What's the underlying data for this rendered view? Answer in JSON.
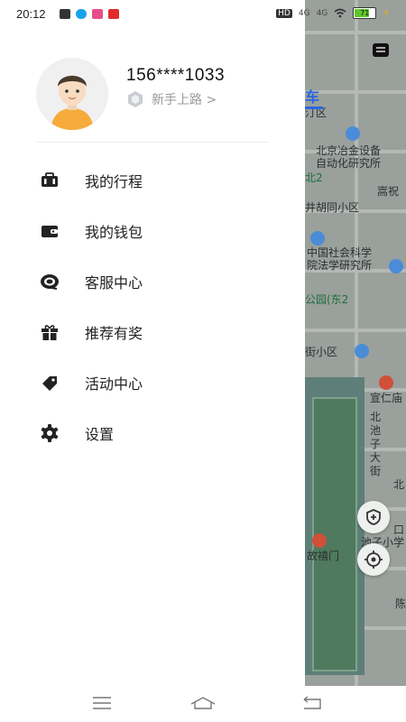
{
  "status_bar": {
    "time": "20:12",
    "network_labels": [
      "HD",
      "4G",
      "4G"
    ],
    "battery": "71",
    "battery_level": 0.71
  },
  "drawer": {
    "user": {
      "phone": "156****1033",
      "level": "新手上路 >"
    },
    "menu": [
      {
        "label": "我的行程",
        "icon": "suitcase-icon"
      },
      {
        "label": "我的钱包",
        "icon": "wallet-icon"
      },
      {
        "label": "客服中心",
        "icon": "headset-icon"
      },
      {
        "label": "推荐有奖",
        "icon": "gift-icon"
      },
      {
        "label": "活动中心",
        "icon": "tag-icon"
      },
      {
        "label": "设置",
        "icon": "gear-icon"
      }
    ]
  },
  "map": {
    "tab": "车",
    "labels": {
      "l1": "汀区",
      "l2": "北京冶金设备",
      "l3": "自动化研究所",
      "l4": "北2",
      "l5": "嵩祝",
      "l6": "井胡同小区",
      "l7": "中国社会科学",
      "l8": "院法学研究所",
      "l9": "公园(东2",
      "l10": "街小区",
      "l11": "宣仁庙",
      "l12": "北池子大街",
      "l13": "北",
      "l14": "口",
      "l15": "池子小学",
      "l16": "故禧门",
      "l17": "陈"
    }
  }
}
